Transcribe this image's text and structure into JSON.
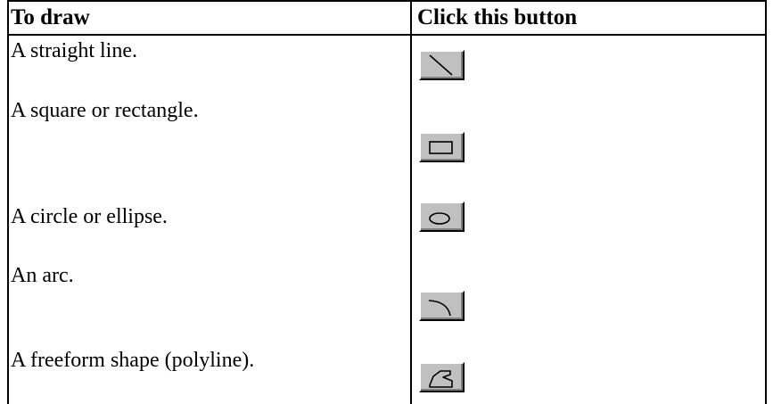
{
  "table": {
    "headers": {
      "col1": "To draw",
      "col2": "Click this button"
    },
    "rows": [
      {
        "text": "A straight line.",
        "icon": "line-icon"
      },
      {
        "text": "A square or rectangle.",
        "icon": "rectangle-icon"
      },
      {
        "text": "A circle or ellipse.",
        "icon": "ellipse-icon"
      },
      {
        "text": "An arc.",
        "icon": "arc-icon"
      },
      {
        "text": "A freeform shape (polyline).",
        "icon": "freeform-icon"
      }
    ]
  }
}
